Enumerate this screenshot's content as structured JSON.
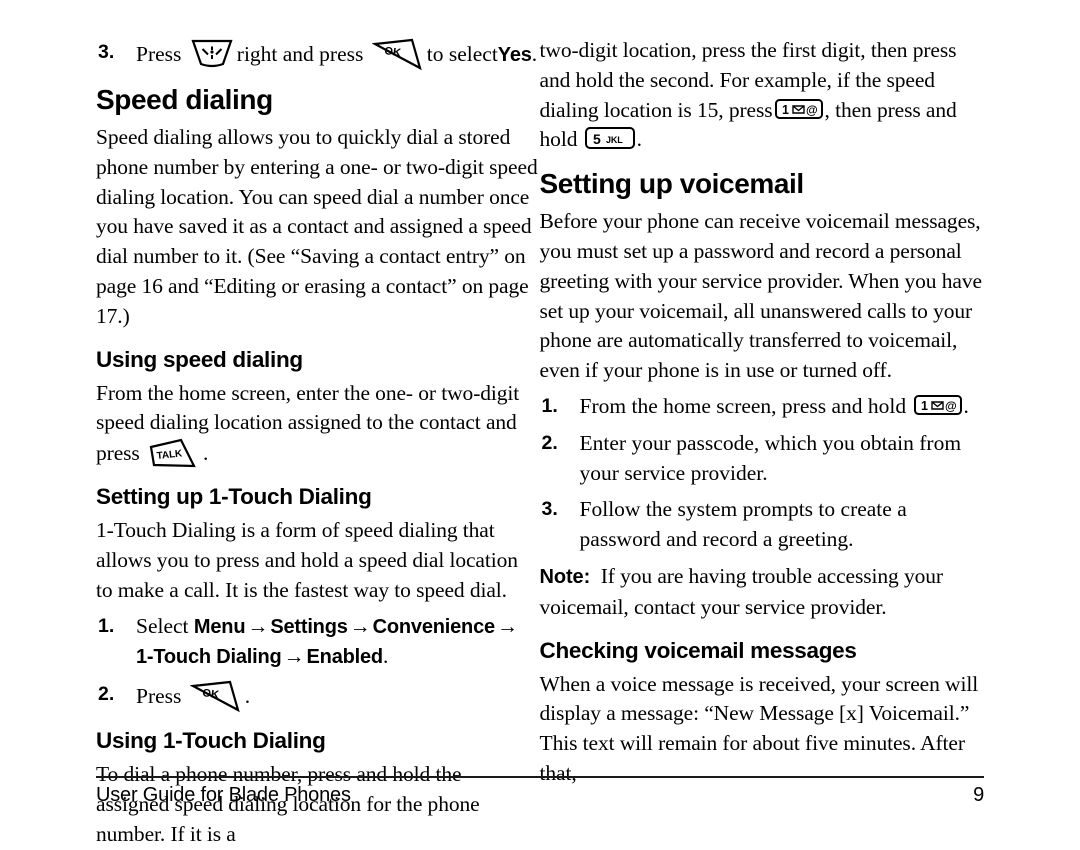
{
  "document": {
    "title": "User Guide for Blade Phones",
    "page_number": "9"
  },
  "left_column": {
    "step3": {
      "number": "3.",
      "text_before": "Press",
      "text_middle": "right and press",
      "text_after": "to select",
      "bold_word": "Yes",
      "period": ".",
      "icon_nav": "navigation-key-icon",
      "icon_ok": "ok-key-icon"
    },
    "heading_speed_dialing": "Speed dialing",
    "para_speed_dialing": "Speed dialing allows you to quickly dial a stored phone number by entering a one- or two-digit speed dialing location. You can speed dial a number once you have saved it as a contact and assigned a speed dial number to it. (See “Saving a contact entry” on page 16 and “Editing or erasing a contact” on page 17.)",
    "subheading_using_speed_dialing": "Using speed dialing",
    "para_using_speed_dialing_a": "From the home screen, enter the one- or two-digit speed dialing location assigned to the contact and press",
    "para_using_speed_dialing_b": ".",
    "icon_talk": "talk-key-icon",
    "subheading_setting_up_1touch": "Setting up 1-Touch Dialing",
    "para_1touch_intro": "1-Touch Dialing is a form of speed dialing that allows you to press and hold a speed dial location to make a call. It is the fastest way to speed dial.",
    "steps": [
      {
        "number": "1.",
        "lead": "Select",
        "path": [
          "Menu",
          "Settings",
          "Convenience",
          "1-Touch Dialing",
          "Enabled"
        ],
        "arrow": "→",
        "trailing": "."
      },
      {
        "number": "2.",
        "lead": "Press",
        "icon": "ok-key-icon",
        "trailing": "."
      }
    ],
    "subheading_using_1touch": "Using 1-Touch Dialing",
    "para_using_1touch": "To dial a phone number, press and hold the assigned speed dialing location for the phone number. If it is a"
  },
  "right_column": {
    "para_continuation_a": "two-digit location, press the first digit, then press and hold the second. For example, if the speed dialing location is 15, press",
    "para_continuation_b": ", then press and hold",
    "para_continuation_c": ".",
    "icon_key_1": "key-1-icon",
    "icon_key_5": "key-5-icon",
    "key_1_digit": "1",
    "key_1_symbol": "@",
    "key_5_digit": "5",
    "key_5_letters": "JKL",
    "heading_setting_up_voicemail": "Setting up voicemail",
    "para_voicemail_intro": "Before your phone can receive voicemail messages, you must set up a password and record a personal greeting with your service provider. When you have set up your voicemail, all unanswered calls to your phone are automatically transferred to voicemail, even if your phone is in use or turned off.",
    "steps": [
      {
        "number": "1.",
        "text_before": "From the home screen, press and hold",
        "icon": "key-1-icon",
        "trailing": "."
      },
      {
        "number": "2.",
        "text_before": "Enter your passcode, which you obtain from your service provider.",
        "icon": "",
        "trailing": ""
      },
      {
        "number": "3.",
        "text_before": "Follow the system prompts to create a password and record a greeting.",
        "icon": "",
        "trailing": ""
      }
    ],
    "note_label": "Note:",
    "note_text": "If you are having trouble accessing your voicemail, contact your service provider.",
    "subheading_checking_voicemail": "Checking voicemail messages",
    "para_checking_voicemail": "When a voice message is received, your screen will display a message: “New Message [x] Voicemail.” This text will remain for about five minutes. After that,"
  }
}
